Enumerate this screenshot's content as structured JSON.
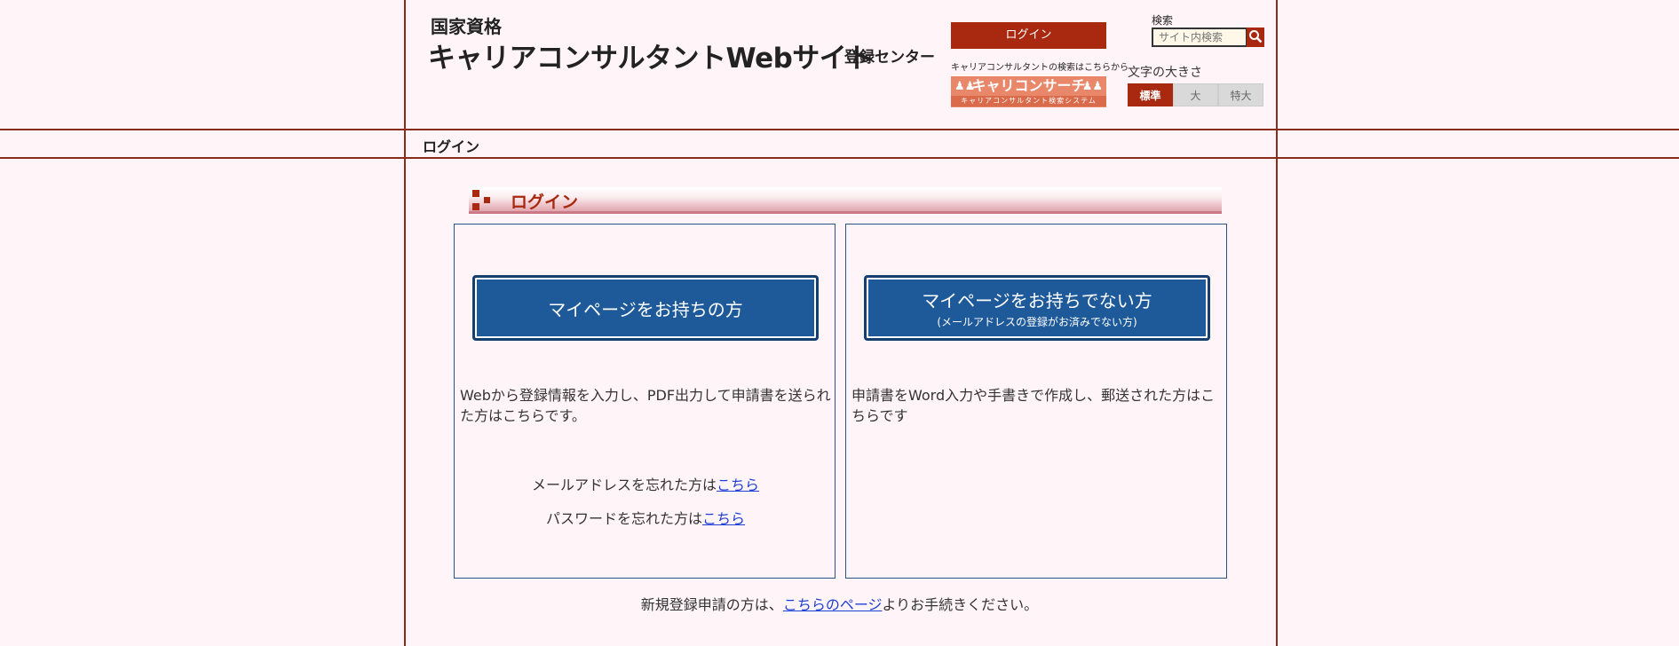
{
  "header": {
    "logo_small": "国家資格",
    "logo_main": "キャリアコンサルタントWebサイト",
    "logo_sub": "登録センター",
    "login_button": "ログイン",
    "search_caption": "キャリアコンサルタントの検索はこちらから",
    "banner_title": "キャリコンサーチ",
    "banner_sub": "キャリアコンサルタント検索システム",
    "search_label": "検索",
    "search_placeholder": "サイト内検索",
    "fontsize_label": "文字の大きさ",
    "fontsize_options": [
      "標準",
      "大",
      "特大"
    ],
    "fontsize_selected": "標準"
  },
  "breadcrumb": "ログイン",
  "section_title": "ログイン",
  "left_panel": {
    "button_label": "マイページをお持ちの方",
    "description": "Webから登録情報を入力し、PDF出力して申請書を送られた方はこちらです。",
    "email_forgot_text": "メールアドレスを忘れた方は",
    "email_forgot_link": "こちら",
    "password_forgot_text": "パスワードを忘れた方は",
    "password_forgot_link": "こちら"
  },
  "right_panel": {
    "button_label": "マイページをお持ちでない方",
    "button_sublabel": "(メールアドレスの登録がお済みでない方)",
    "description": "申請書をWord入力や手書きで作成し、郵送された方はこちらです"
  },
  "footer": {
    "prefix": "新規登録申請の方は、",
    "link": "こちらのページ",
    "suffix": "よりお手続きください。"
  },
  "colors": {
    "accent": "#a8290f",
    "button_blue": "#1e5a9a",
    "background": "#fff5f8",
    "link": "#1f3fd6"
  }
}
